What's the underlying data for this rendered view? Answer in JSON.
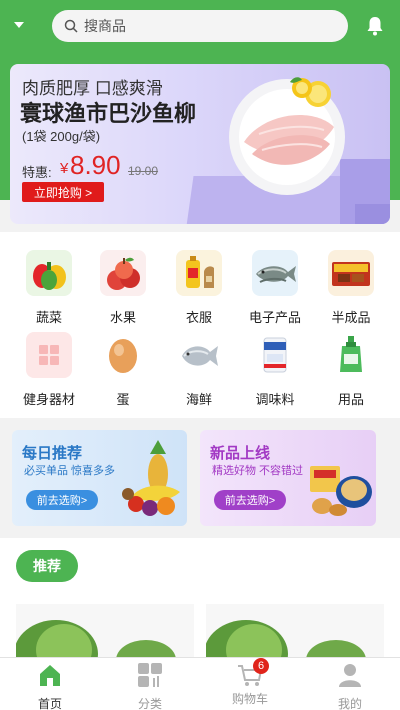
{
  "search": {
    "placeholder": "搜商品"
  },
  "banner": {
    "subtitle": "肉质肥厚 口感爽滑",
    "title": "寰球渔市巴沙鱼柳",
    "unit": "(1袋 200g/袋)",
    "price_label": "特惠:",
    "currency": "¥",
    "price": "8.90",
    "old_price": "19.00",
    "cta": "立即抢购 >"
  },
  "categories": [
    {
      "label": "蔬菜",
      "icon": "pepper-icon"
    },
    {
      "label": "水果",
      "icon": "apple-icon"
    },
    {
      "label": "衣服",
      "icon": "oil-bottle-icon"
    },
    {
      "label": "电子产品",
      "icon": "fish-icon"
    },
    {
      "label": "半成品",
      "icon": "snack-box-icon"
    },
    {
      "label": "健身器材",
      "icon": "grid-icon"
    },
    {
      "label": "蛋",
      "icon": "egg-icon"
    },
    {
      "label": "海鲜",
      "icon": "pomfret-icon"
    },
    {
      "label": "调味料",
      "icon": "salt-bag-icon"
    },
    {
      "label": "用品",
      "icon": "detergent-icon"
    }
  ],
  "promos": [
    {
      "title": "每日推荐",
      "subtitle": "必买单品 惊喜多多",
      "button": "前去选购>"
    },
    {
      "title": "新品上线",
      "subtitle": "精选好物 不容错过",
      "button": "前去选购>"
    }
  ],
  "recommend": {
    "label": "推荐"
  },
  "tabs": [
    {
      "label": "首页",
      "icon": "home-icon",
      "active": true
    },
    {
      "label": "分类",
      "icon": "category-icon",
      "active": false
    },
    {
      "label": "购物车",
      "icon": "cart-icon",
      "active": false,
      "badge": "6"
    },
    {
      "label": "我的",
      "icon": "user-icon",
      "active": false
    }
  ],
  "colors": {
    "brand": "#4db452",
    "price": "#e02424",
    "badge": "#e0241b"
  }
}
